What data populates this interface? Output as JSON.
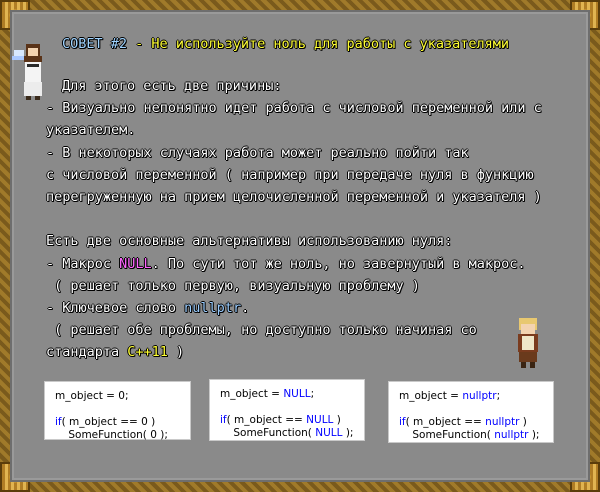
{
  "header": {
    "prefix": "СОВЕТ ",
    "number": "#2",
    "title": " - Не используйте ноль для работы с указателями"
  },
  "body": {
    "intro": "Для этого есть две причины:",
    "reason1_line1": "- Визуально непонятно идет работа с числовой переменной или с",
    "reason1_line2": "указателем.",
    "reason2_line1": "- В некоторых случаях работа может реально пойти так",
    "reason2_line2": "с числовой переменной ( например при передаче нуля в функцию",
    "reason2_line3": "перегруженную на прием целочисленной переменной и указателя )",
    "alt_intro": "Есть две основные альтернативы использованию нуля:",
    "macro_prefix": "- Макрос ",
    "macro_kw": "NULL",
    "macro_suffix": ". По сути тот же ноль, но завернутый в макрос.",
    "macro_note": " ( решает только первую, визуальную проблему )",
    "keyword_prefix": "- Ключевое слово ",
    "keyword_kw": "nullptr",
    "keyword_suffix": ".",
    "keyword_note": " ( решает обе проблемы, но доступно только начиная со",
    "std_prefix": "стандарта ",
    "std_kw": "C++11",
    "std_suffix": " )"
  },
  "code_samples": [
    {
      "line1": "m_object = 0;",
      "line2_pre": "if( m_object == 0 )",
      "line3": "    SomeFunction( 0 );"
    },
    {
      "line1_pre": "m_object = ",
      "line1_kw": "NULL",
      "line1_post": ";",
      "line2_pre": "if( m_object == ",
      "line2_kw": "NULL",
      "line2_post": " )",
      "line3_pre": "    SomeFunction( ",
      "line3_kw": "NULL",
      "line3_post": " );"
    },
    {
      "line1_pre": "m_object = ",
      "line1_kw": "nullptr",
      "line1_post": ";",
      "line2_pre": "if( m_object == ",
      "line2_kw": "nullptr",
      "line2_post": " )",
      "line3_pre": "    SomeFunction( ",
      "line3_kw": "nullptr",
      "line3_post": " );"
    }
  ],
  "colors": {
    "panel": "#8a8a8a",
    "text": "#ffffff",
    "header_title": "#ffff33",
    "header_number": "#9fd3ff",
    "null_kw": "#ff66ff",
    "nullptr_kw": "#99ccff",
    "cpp_kw": "#ffff33",
    "code_kw": "#0000ff"
  },
  "icons": [
    "pixel-girl-sprite-icon",
    "pixel-boy-sprite-icon",
    "ornament-corner-icon"
  ]
}
